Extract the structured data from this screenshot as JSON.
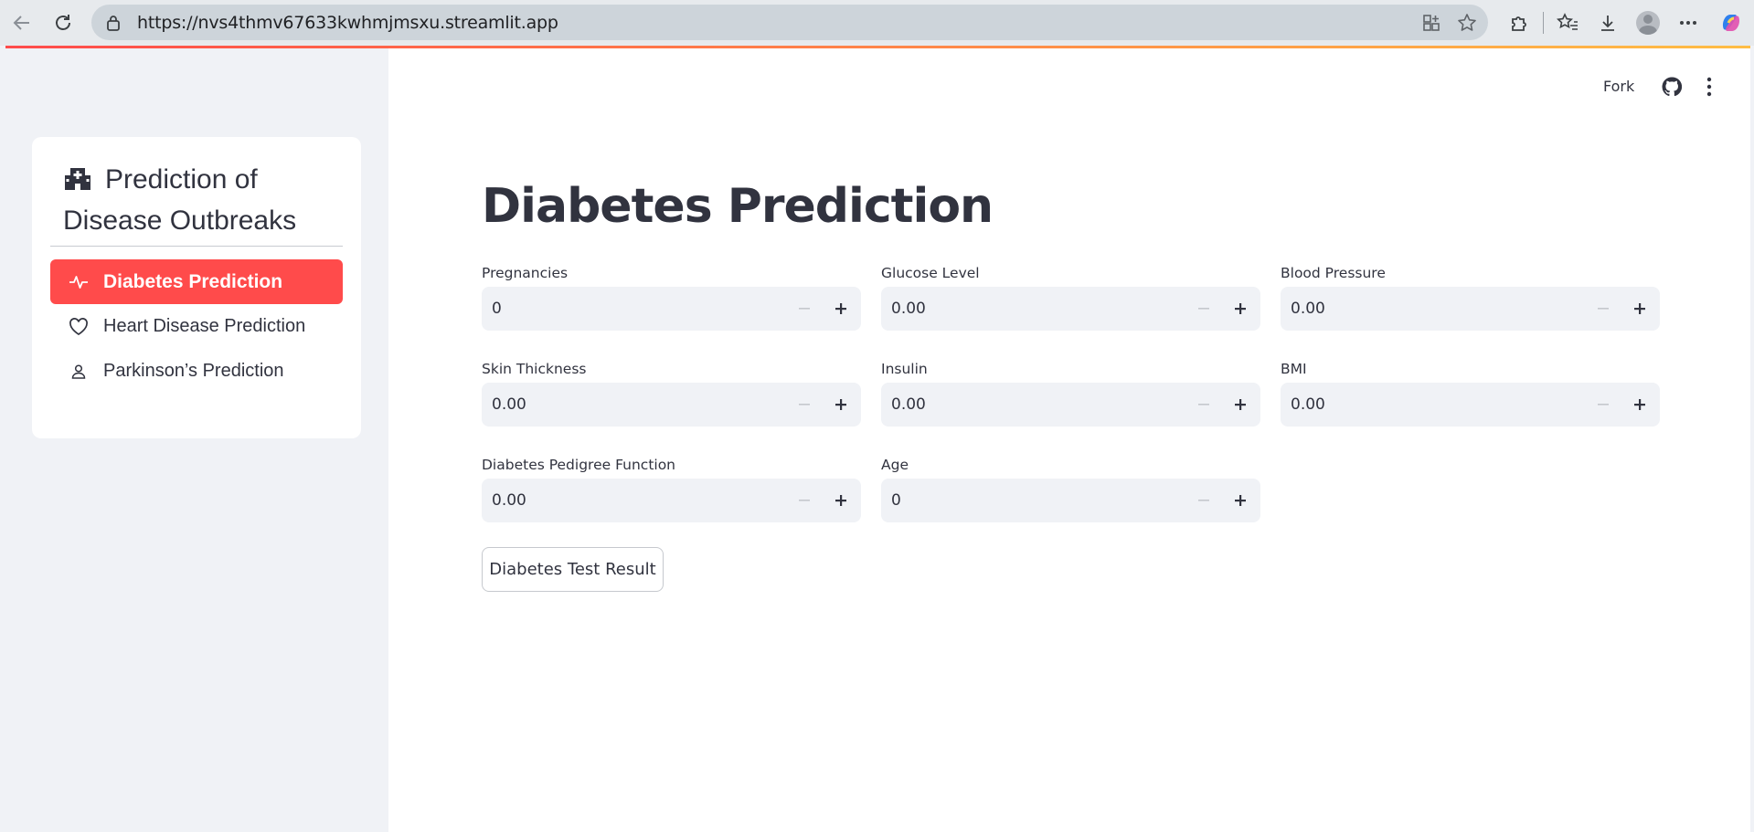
{
  "browser": {
    "url": "https://nvs4thmv67633kwhmjmsxu.streamlit.app"
  },
  "header": {
    "fork_label": "Fork"
  },
  "sidebar": {
    "title": "Prediction of Disease Outbreaks",
    "items": [
      {
        "label": "Diabetes Prediction",
        "icon": "activity-icon",
        "active": true
      },
      {
        "label": "Heart Disease Prediction",
        "icon": "heart-icon",
        "active": false
      },
      {
        "label": "Parkinson’s Prediction",
        "icon": "person-icon",
        "active": false
      }
    ]
  },
  "main": {
    "title": "Diabetes Prediction",
    "fields": [
      {
        "label": "Pregnancies",
        "value": "0"
      },
      {
        "label": "Glucose Level",
        "value": "0.00"
      },
      {
        "label": "Blood Pressure",
        "value": "0.00"
      },
      {
        "label": "Skin Thickness",
        "value": "0.00"
      },
      {
        "label": "Insulin",
        "value": "0.00"
      },
      {
        "label": "BMI",
        "value": "0.00"
      },
      {
        "label": "Diabetes Pedigree Function",
        "value": "0.00"
      },
      {
        "label": "Age",
        "value": "0"
      }
    ],
    "button_label": "Diabetes Test Result"
  },
  "colors": {
    "accent": "#ff4b4b",
    "text": "#31333f",
    "sidebar_bg": "#f0f2f6",
    "input_bg": "#f0f2f6"
  }
}
